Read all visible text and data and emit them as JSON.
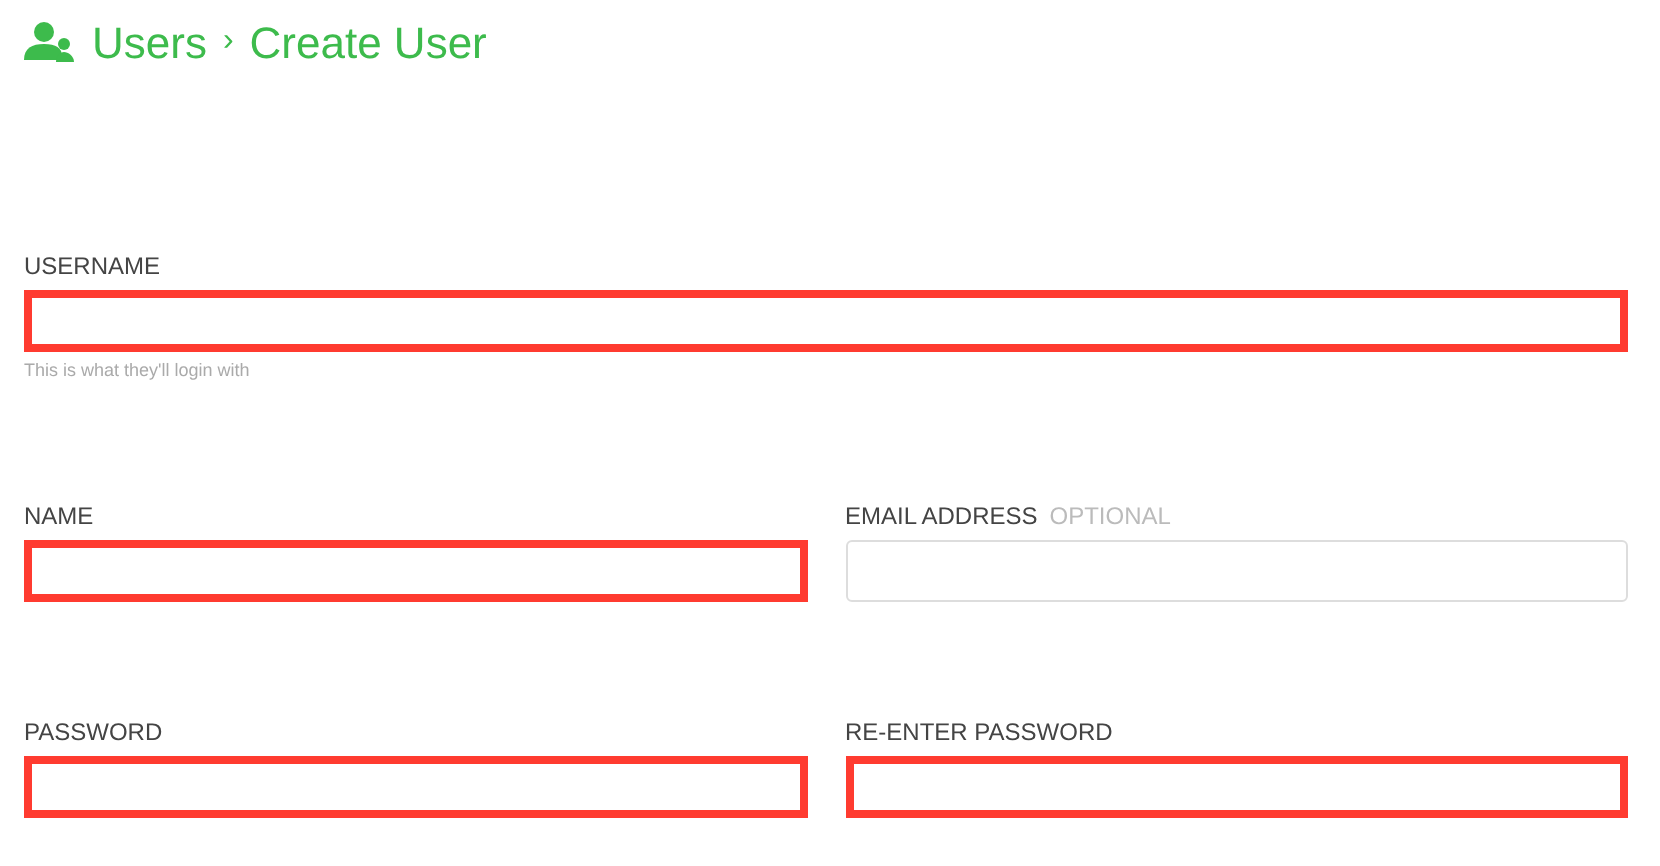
{
  "header": {
    "section": "Users",
    "separator": "›",
    "page": "Create User"
  },
  "rows": [
    {
      "fields": [
        {
          "label": "USERNAME",
          "invalid": true,
          "hint": "This is what they'll login with"
        }
      ]
    },
    {
      "fields": [
        {
          "label": "NAME",
          "invalid": true
        },
        {
          "label": "EMAIL ADDRESS",
          "note": "OPTIONAL",
          "invalid": false
        }
      ]
    },
    {
      "fields": [
        {
          "label": "PASSWORD",
          "invalid": true
        },
        {
          "label": "RE-ENTER PASSWORD",
          "invalid": true
        }
      ]
    }
  ]
}
